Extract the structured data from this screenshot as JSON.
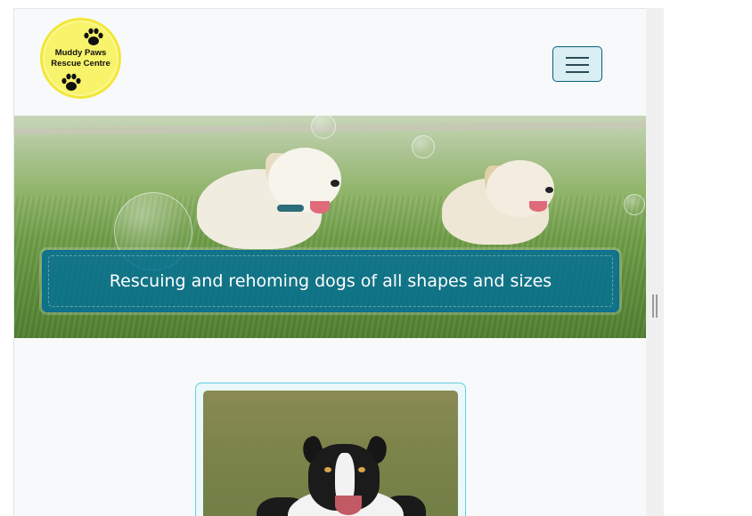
{
  "logo": {
    "line1": "Muddy Paws",
    "line2": "Rescue Centre",
    "icon": "paw-icon",
    "colors": {
      "fill": "#f7f36a",
      "paw": "#111111"
    }
  },
  "navbar": {
    "toggler_icon": "hamburger-menu-icon"
  },
  "hero": {
    "caption": "Rescuing and rehoming dogs of all shapes and sizes",
    "image": "puppies-in-grass-photo",
    "colors": {
      "caption_bg": "#0d6f93"
    }
  },
  "card": {
    "image": "border-collie-photo",
    "colors": {
      "border": "#5fd2e0"
    }
  }
}
